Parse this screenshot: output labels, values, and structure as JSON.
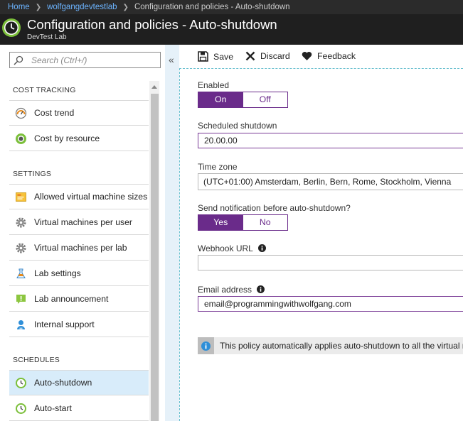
{
  "breadcrumb": {
    "items": [
      "Home",
      "wolfgangdevtestlab",
      "Configuration and policies - Auto-shutdown"
    ],
    "separator": ">"
  },
  "header": {
    "title": "Configuration and policies - Auto-shutdown",
    "subtitle": "DevTest Lab"
  },
  "search": {
    "placeholder": "Search (Ctrl+/)"
  },
  "menu": {
    "sections": [
      {
        "title": "COST TRACKING",
        "items": [
          {
            "label": "Cost trend",
            "icon": "cost-trend-icon"
          },
          {
            "label": "Cost by resource",
            "icon": "cost-by-resource-icon"
          }
        ]
      },
      {
        "title": "SETTINGS",
        "items": [
          {
            "label": "Allowed virtual machine sizes",
            "icon": "vm-sizes-icon"
          },
          {
            "label": "Virtual machines per user",
            "icon": "gear-icon"
          },
          {
            "label": "Virtual machines per lab",
            "icon": "gear-icon"
          },
          {
            "label": "Lab settings",
            "icon": "lab-settings-icon"
          },
          {
            "label": "Lab announcement",
            "icon": "announcement-icon"
          },
          {
            "label": "Internal support",
            "icon": "support-icon"
          }
        ]
      },
      {
        "title": "SCHEDULES",
        "items": [
          {
            "label": "Auto-shutdown",
            "icon": "clock-icon",
            "active": true
          },
          {
            "label": "Auto-start",
            "icon": "clock-icon"
          }
        ]
      }
    ]
  },
  "toolbar": {
    "save": "Save",
    "discard": "Discard",
    "feedback": "Feedback"
  },
  "form": {
    "enabled": {
      "label": "Enabled",
      "on": "On",
      "off": "Off",
      "selected": "On"
    },
    "scheduled_shutdown": {
      "label": "Scheduled shutdown",
      "value": "20.00.00"
    },
    "time_zone": {
      "label": "Time zone",
      "value": "(UTC+01:00) Amsterdam, Berlin, Bern, Rome, Stockholm, Vienna"
    },
    "notification": {
      "label": "Send notification before auto-shutdown?",
      "yes": "Yes",
      "no": "No",
      "selected": "Yes"
    },
    "webhook": {
      "label": "Webhook URL",
      "value": ""
    },
    "email": {
      "label": "Email address",
      "value": "email@programmingwithwolfgang.com"
    },
    "info": "This policy automatically applies auto-shutdown to all the virtual machines in this lab."
  },
  "colors": {
    "accent": "#6a2b8a",
    "active_item": "#d8ecfa",
    "link": "#6cb4ff",
    "header_bg": "#1f1f1f"
  }
}
